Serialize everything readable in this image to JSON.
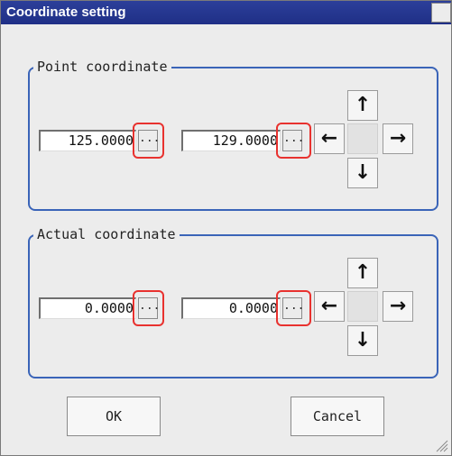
{
  "window": {
    "title": "Coordinate setting"
  },
  "point_group": {
    "label": "Point coordinate",
    "x_value": "125.0000",
    "y_value": "129.0000",
    "ellipsis_label": "..."
  },
  "actual_group": {
    "label": "Actual coordinate",
    "x_value": "0.0000",
    "y_value": "0.0000",
    "ellipsis_label": "..."
  },
  "arrows": {
    "up": "↑",
    "down": "↓",
    "left": "←",
    "right": "→"
  },
  "buttons": {
    "ok_label": "OK",
    "cancel_label": "Cancel"
  },
  "colors": {
    "title_bar": "#1f2f86",
    "group_border": "#3a64b8",
    "callout": "#e8322f"
  }
}
